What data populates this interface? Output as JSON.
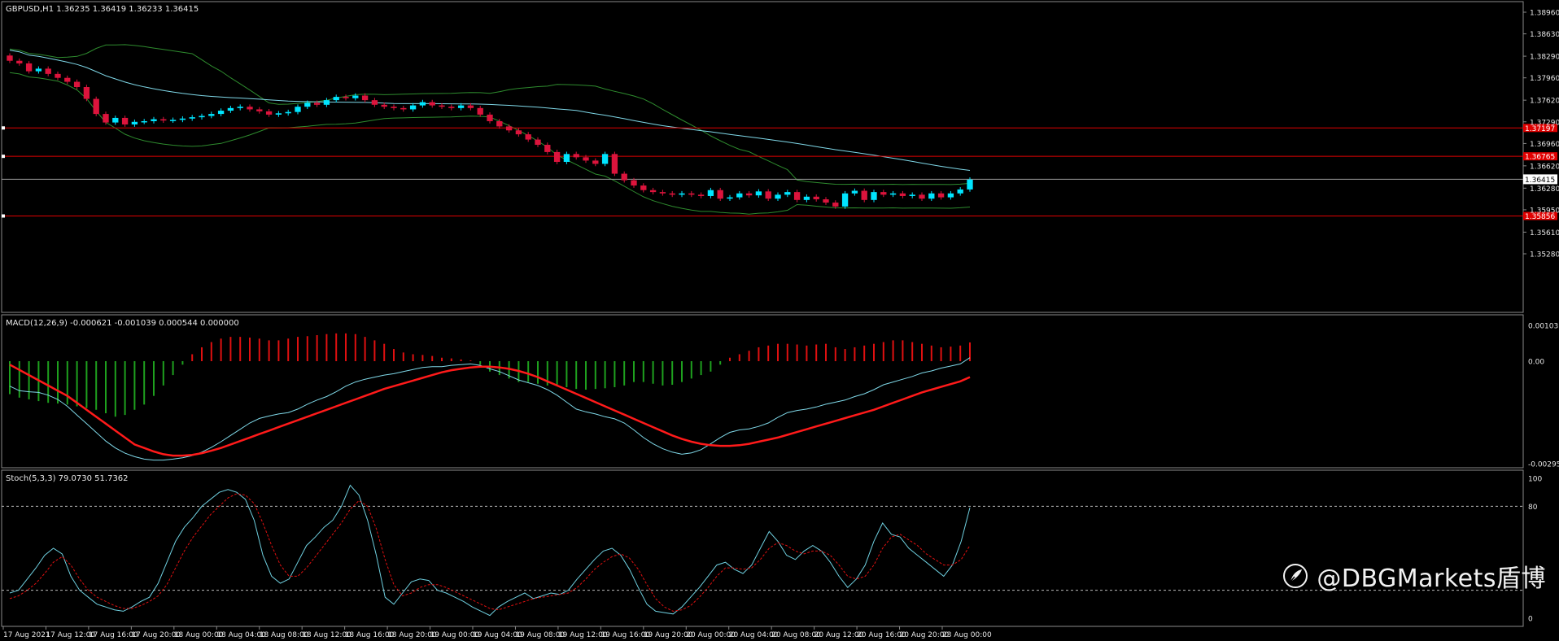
{
  "colors": {
    "background": "#000000",
    "bull": "#00e5ff",
    "bear": "#dc143c",
    "ma": "#7fd8e8",
    "band": "#2e8b2e",
    "level": "#e00000",
    "macd_pos": "#e01010",
    "macd_neg": "#1ea01e",
    "macd_main": "#7fd8e8",
    "macd_signal": "#ff1a1a",
    "stoch_main": "#6fd0e0",
    "stoch_signal": "#e01010",
    "grid_text": "#e8e8e8"
  },
  "main_panel": {
    "header": "GBPUSD,H1  1.36235 1.36419 1.36233 1.36415",
    "price_ticks": [
      "1.38960",
      "1.38630",
      "1.38290",
      "1.37960",
      "1.37620",
      "1.37290",
      "1.36960",
      "1.36620",
      "1.36280",
      "1.35950",
      "1.35610",
      "1.35280"
    ],
    "current_price_label": "1.36415",
    "hlines": [
      {
        "label": "1.37197",
        "price": 1.37197
      },
      {
        "label": "1.36765",
        "price": 1.36765
      },
      {
        "label": "1.35856",
        "price": 1.35856
      }
    ],
    "current_price": 1.36415
  },
  "macd_panel": {
    "header": "MACD(12,26,9) -0.000621 -0.001039 0.000544 0.000000",
    "ticks": [
      "0.001031",
      "0.00",
      "-0.002952"
    ]
  },
  "stoch_panel": {
    "header": "Stoch(5,3,3) 79.0730 51.7362",
    "ticks": [
      "100",
      "80",
      "0"
    ],
    "levels": [
      80,
      20
    ]
  },
  "time_axis": {
    "labels": [
      "17 Aug 2021",
      "17 Aug 12:00",
      "17 Aug 16:00",
      "17 Aug 20:00",
      "18 Aug 00:00",
      "18 Aug 04:00",
      "18 Aug 08:00",
      "18 Aug 12:00",
      "18 Aug 16:00",
      "18 Aug 20:00",
      "19 Aug 00:00",
      "19 Aug 04:00",
      "19 Aug 08:00",
      "19 Aug 12:00",
      "19 Aug 16:00",
      "19 Aug 20:00",
      "20 Aug 00:00",
      "20 Aug 04:00",
      "20 Aug 08:00",
      "20 Aug 12:00",
      "20 Aug 16:00",
      "20 Aug 20:00",
      "23 Aug 00:00"
    ]
  },
  "watermark": {
    "text": "@DBGMarkets盾博",
    "icon": "feather-logo-icon"
  },
  "chart_data": [
    {
      "type": "candlestick",
      "title": "GBPUSD,H1",
      "ylim": [
        1.3528,
        1.391
      ],
      "ohlc_closes": [
        1.3822,
        1.3818,
        1.3806,
        1.381,
        1.3802,
        1.3796,
        1.379,
        1.3782,
        1.3764,
        1.3741,
        1.3728,
        1.3735,
        1.3725,
        1.3729,
        1.373,
        1.3733,
        1.3731,
        1.3732,
        1.3734,
        1.3736,
        1.3738,
        1.3741,
        1.3746,
        1.375,
        1.3752,
        1.3748,
        1.3745,
        1.374,
        1.3742,
        1.3744,
        1.3752,
        1.3758,
        1.3755,
        1.3762,
        1.3767,
        1.3765,
        1.3769,
        1.3762,
        1.3755,
        1.3752,
        1.375,
        1.3748,
        1.3754,
        1.3759,
        1.3754,
        1.3752,
        1.375,
        1.3754,
        1.375,
        1.374,
        1.373,
        1.3722,
        1.3716,
        1.371,
        1.3702,
        1.3694,
        1.3683,
        1.3668,
        1.368,
        1.3675,
        1.367,
        1.3665,
        1.368,
        1.365,
        1.364,
        1.3632,
        1.3625,
        1.3622,
        1.362,
        1.3618,
        1.362,
        1.3618,
        1.3616,
        1.3625,
        1.3612,
        1.3614,
        1.362,
        1.3617,
        1.3623,
        1.3612,
        1.3618,
        1.3622,
        1.361,
        1.3615,
        1.3611,
        1.3606,
        1.36,
        1.362,
        1.3624,
        1.361,
        1.3622,
        1.3618,
        1.362,
        1.3616,
        1.3618,
        1.3612,
        1.362,
        1.3614,
        1.362,
        1.3626,
        1.3641
      ]
    },
    {
      "type": "bar",
      "title": "MACD(12,26,9)",
      "ylim": [
        -0.002952,
        0.001031
      ],
      "values": [
        -0.00095,
        -0.00105,
        -0.0011,
        -0.00115,
        -0.0012,
        -0.00122,
        -0.00125,
        -0.0013,
        -0.00135,
        -0.0014,
        -0.0015,
        -0.0016,
        -0.00155,
        -0.0014,
        -0.00125,
        -0.001,
        -0.0007,
        -0.0004,
        -0.0001,
        0.0002,
        0.0004,
        0.00055,
        0.00065,
        0.0007,
        0.0007,
        0.00068,
        0.00065,
        0.0006,
        0.0006,
        0.00065,
        0.0007,
        0.00072,
        0.00075,
        0.00078,
        0.0008,
        0.0008,
        0.00078,
        0.0007,
        0.0006,
        0.0005,
        0.00035,
        0.00025,
        0.0002,
        0.00018,
        0.00015,
        0.0001,
        8e-05,
        5e-05,
        2e-05,
        -0.0001,
        -0.0003,
        -0.0004,
        -0.0005,
        -0.0006,
        -0.0006,
        -0.00065,
        -0.0007,
        -0.0007,
        -0.00075,
        -0.0008,
        -0.00082,
        -0.0008,
        -0.00078,
        -0.00075,
        -0.0007,
        -0.0006,
        -0.0006,
        -0.00065,
        -0.0007,
        -0.00068,
        -0.0006,
        -0.0005,
        -0.0004,
        -0.0003,
        -0.0001,
        0.0001,
        0.0002,
        0.0003,
        0.0004,
        0.00045,
        0.0005,
        0.0005,
        0.00048,
        0.00045,
        0.00048,
        0.0005,
        0.0004,
        0.00035,
        0.0004,
        0.00045,
        0.0005,
        0.00055,
        0.0006,
        0.0006,
        0.00055,
        0.0005,
        0.00045,
        0.0004,
        0.00042,
        0.00045,
        0.00054
      ],
      "series": [
        {
          "name": "MACD",
          "values": [
            -0.00072,
            -0.00085,
            -0.00088,
            -0.0009,
            -0.00098,
            -0.0011,
            -0.0013,
            -0.00155,
            -0.0018,
            -0.00205,
            -0.0023,
            -0.0025,
            -0.00265,
            -0.00275,
            -0.00282,
            -0.00285,
            -0.00285,
            -0.00282,
            -0.00278,
            -0.00272,
            -0.00262,
            -0.00248,
            -0.00232,
            -0.00214,
            -0.00196,
            -0.00178,
            -0.00165,
            -0.00158,
            -0.00152,
            -0.00148,
            -0.00138,
            -0.00124,
            -0.00112,
            -0.00102,
            -0.00088,
            -0.00072,
            -0.0006,
            -0.00052,
            -0.00046,
            -0.0004,
            -0.00036,
            -0.0003,
            -0.00024,
            -0.00018,
            -0.00016,
            -0.00016,
            -0.00012,
            -0.0001,
            -8e-05,
            -0.00012,
            -0.00022,
            -0.0003,
            -0.00042,
            -0.00054,
            -0.00062,
            -0.0007,
            -0.00082,
            -0.00098,
            -0.00118,
            -0.00138,
            -0.00146,
            -0.00152,
            -0.0016,
            -0.00166,
            -0.00178,
            -0.00198,
            -0.0022,
            -0.00238,
            -0.00252,
            -0.00262,
            -0.00268,
            -0.00264,
            -0.00255,
            -0.00238,
            -0.0022,
            -0.00205,
            -0.00198,
            -0.00195,
            -0.00188,
            -0.00178,
            -0.00162,
            -0.00148,
            -0.00142,
            -0.00138,
            -0.00132,
            -0.00124,
            -0.00118,
            -0.00112,
            -0.00102,
            -0.00094,
            -0.00082,
            -0.00068,
            -0.0006,
            -0.00052,
            -0.00044,
            -0.00034,
            -0.00028,
            -0.0002,
            -0.00014,
            -8e-05,
            0.0001
          ]
        },
        {
          "name": "Signal",
          "values": [
            -0.0001,
            -0.00025,
            -0.0004,
            -0.00055,
            -0.0007,
            -0.00085,
            -0.001,
            -0.0012,
            -0.0014,
            -0.0016,
            -0.0018,
            -0.002,
            -0.0022,
            -0.0024,
            -0.0025,
            -0.0026,
            -0.00268,
            -0.00272,
            -0.00272,
            -0.0027,
            -0.00265,
            -0.00258,
            -0.0025,
            -0.0024,
            -0.0023,
            -0.0022,
            -0.0021,
            -0.002,
            -0.0019,
            -0.0018,
            -0.0017,
            -0.0016,
            -0.0015,
            -0.0014,
            -0.0013,
            -0.0012,
            -0.0011,
            -0.001,
            -0.0009,
            -0.0008,
            -0.00072,
            -0.00064,
            -0.00056,
            -0.00048,
            -0.0004,
            -0.00032,
            -0.00026,
            -0.00022,
            -0.00018,
            -0.00016,
            -0.00016,
            -0.00018,
            -0.00022,
            -0.00028,
            -0.00036,
            -0.00046,
            -0.00058,
            -0.0007,
            -0.00082,
            -0.00094,
            -0.00106,
            -0.00118,
            -0.0013,
            -0.00142,
            -0.00154,
            -0.00166,
            -0.00178,
            -0.0019,
            -0.00202,
            -0.00214,
            -0.00224,
            -0.00232,
            -0.00238,
            -0.00242,
            -0.00244,
            -0.00244,
            -0.00242,
            -0.00238,
            -0.00232,
            -0.00226,
            -0.0022,
            -0.00212,
            -0.00204,
            -0.00196,
            -0.00188,
            -0.0018,
            -0.00172,
            -0.00164,
            -0.00156,
            -0.00148,
            -0.0014,
            -0.0013,
            -0.0012,
            -0.0011,
            -0.001,
            -0.0009,
            -0.00082,
            -0.00074,
            -0.00066,
            -0.00058,
            -0.00046
          ]
        }
      ]
    },
    {
      "type": "line",
      "title": "Stoch(5,3,3)",
      "ylim": [
        0,
        100
      ],
      "series": [
        {
          "name": "%K",
          "values": [
            18,
            20,
            28,
            36,
            45,
            50,
            46,
            30,
            20,
            15,
            10,
            8,
            6,
            5,
            8,
            12,
            15,
            25,
            40,
            55,
            65,
            72,
            80,
            85,
            90,
            92,
            90,
            85,
            70,
            45,
            30,
            25,
            28,
            40,
            52,
            58,
            65,
            70,
            80,
            95,
            88,
            70,
            45,
            15,
            10,
            18,
            26,
            28,
            27,
            20,
            18,
            15,
            12,
            8,
            5,
            2,
            8,
            12,
            15,
            18,
            14,
            16,
            18,
            17,
            20,
            28,
            35,
            42,
            48,
            50,
            45,
            35,
            22,
            10,
            5,
            4,
            3,
            8,
            15,
            22,
            30,
            38,
            40,
            35,
            32,
            38,
            50,
            62,
            55,
            45,
            42,
            48,
            52,
            48,
            40,
            30,
            22,
            28,
            38,
            55,
            68,
            60,
            58,
            50,
            45,
            40,
            35,
            30,
            38,
            55,
            79
          ]
        },
        {
          "name": "%D",
          "values": [
            14,
            16,
            20,
            25,
            32,
            40,
            44,
            38,
            28,
            20,
            15,
            12,
            9,
            7,
            7,
            9,
            12,
            16,
            24,
            36,
            48,
            58,
            66,
            74,
            80,
            86,
            89,
            88,
            82,
            68,
            52,
            38,
            30,
            30,
            36,
            44,
            52,
            60,
            68,
            78,
            84,
            80,
            64,
            42,
            24,
            16,
            18,
            22,
            24,
            24,
            22,
            19,
            16,
            13,
            10,
            7,
            6,
            8,
            10,
            12,
            14,
            15,
            16,
            17,
            18,
            22,
            28,
            35,
            40,
            44,
            46,
            43,
            35,
            24,
            14,
            8,
            5,
            6,
            9,
            15,
            22,
            30,
            36,
            36,
            35,
            36,
            42,
            50,
            54,
            52,
            48,
            46,
            48,
            48,
            45,
            38,
            30,
            28,
            30,
            38,
            50,
            58,
            60,
            56,
            52,
            46,
            42,
            38,
            38,
            42,
            52
          ]
        }
      ]
    }
  ]
}
